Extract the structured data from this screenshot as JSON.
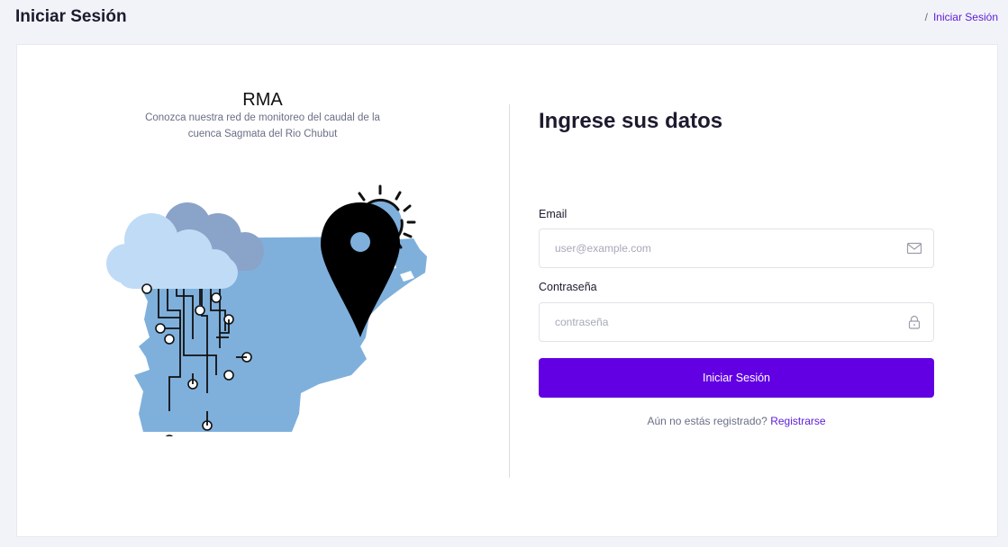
{
  "header": {
    "title": "Iniciar Sesión",
    "breadcrumb_separator": "/",
    "breadcrumb_current": "Iniciar Sesión"
  },
  "intro": {
    "title": "RMA",
    "description": "Conozca nuestra red de monitoreo del caudal de la cuenca Sagmata del Rio Chubut"
  },
  "form": {
    "title": "Ingrese sus datos",
    "email_label": "Email",
    "email_placeholder": "user@example.com",
    "email_value": "",
    "password_label": "Contraseña",
    "password_placeholder": "contraseña",
    "password_value": "",
    "submit_label": "Iniciar Sesión",
    "register_prompt": "Aún no estás registrado?",
    "register_link": "Registrarse"
  },
  "icons": {
    "email": "mail-icon",
    "password": "lock-icon"
  },
  "colors": {
    "accent": "#6200e3",
    "link": "#5b1bd6",
    "map": "#7fb0dc",
    "cloud_front": "#c0dbf5",
    "cloud_back": "#8aa3c8"
  }
}
